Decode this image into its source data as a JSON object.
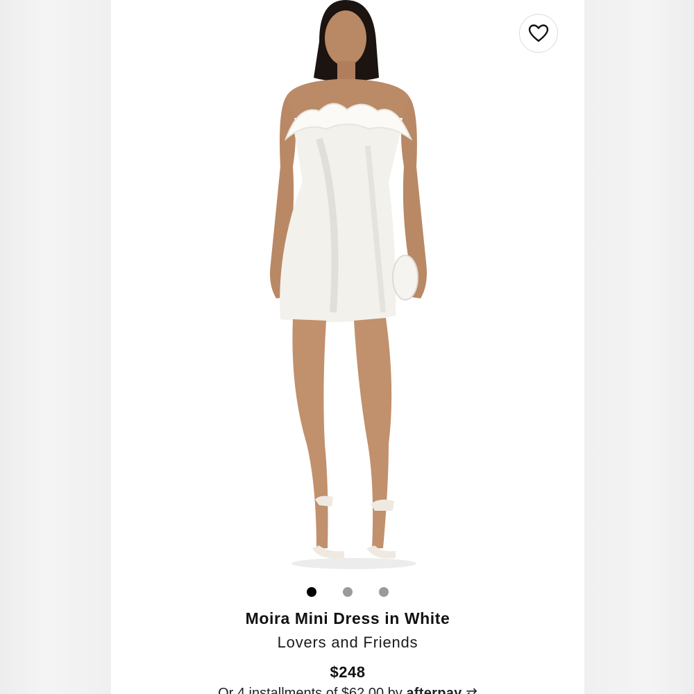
{
  "product": {
    "title": "Moira Mini Dress in White",
    "brand": "Lovers and Friends",
    "price": "$248",
    "installments_prefix": "Or 4 installments of $62.00 by",
    "afterpay_label": "afterpay"
  },
  "gallery": {
    "image_count": 3,
    "active_index": 0
  },
  "icons": {
    "favorite": "heart-outline-icon",
    "afterpay": "afterpay-arrows-icon"
  },
  "colors": {
    "dot_active": "#000000",
    "dot_inactive": "#9a9a9a",
    "background": "#ffffff"
  }
}
